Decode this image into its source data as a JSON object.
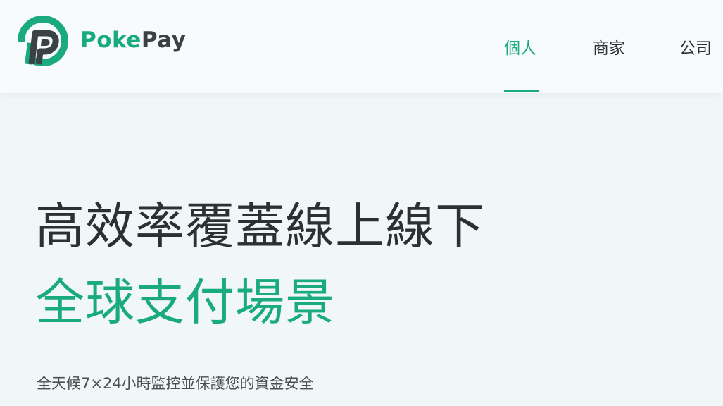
{
  "brand": {
    "name_part1": "Poke",
    "name_part2": "Pay",
    "logo_icon": "pokepay-logo-icon",
    "accent_color": "#1aaa80"
  },
  "nav": {
    "items": [
      {
        "label": "個人",
        "active": true
      },
      {
        "label": "商家",
        "active": false
      },
      {
        "label": "公司",
        "active": false
      }
    ]
  },
  "hero": {
    "headline_line1": "高效率覆蓋線上線下",
    "headline_line2": "全球支付場景",
    "subtitle": "全天候7×24小時監控並保護您的資金安全"
  }
}
